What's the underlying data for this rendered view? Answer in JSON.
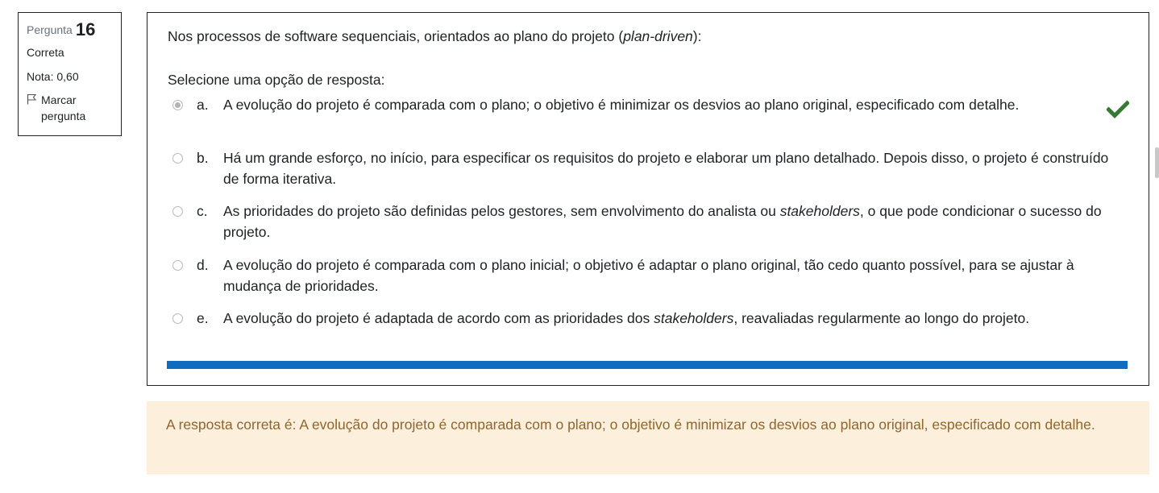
{
  "question_info": {
    "label": "Pergunta",
    "number": "16",
    "state": "Correta",
    "grade": "Nota: 0,60",
    "flag_label": "Marcar pergunta"
  },
  "question": {
    "text_before": "Nos processos de software sequenciais, orientados ao plano do projeto (",
    "text_italic": "plan-driven",
    "text_after": "):",
    "prompt": "Selecione uma opção de resposta:",
    "options": [
      {
        "letter": "a.",
        "text_before": "A evolução do projeto é comparada com o plano; o objetivo é minimizar os desvios ao plano original, especificado com detalhe.",
        "italic": "",
        "text_after": "",
        "selected": true,
        "correct": true
      },
      {
        "letter": "b.",
        "text_before": "Há um grande esforço, no início, para especificar os requisitos do projeto e elaborar um plano detalhado. Depois disso, o projeto é construído de forma iterativa.",
        "italic": "",
        "text_after": "",
        "selected": false
      },
      {
        "letter": "c.",
        "text_before": "As prioridades do projeto são definidas pelos gestores, sem envolvimento do analista ou ",
        "italic": "stakeholders",
        "text_after": ", o que pode condicionar o sucesso do projeto.",
        "selected": false
      },
      {
        "letter": "d.",
        "text_before": "A evolução do projeto é comparada com o plano inicial; o objetivo é adaptar o plano original, tão cedo quanto possível, para se ajustar à mudança de prioridades.",
        "italic": "",
        "text_after": "",
        "selected": false
      },
      {
        "letter": "e.",
        "text_before": "A evolução do projeto é adaptada de acordo com as prioridades dos ",
        "italic": "stakeholders",
        "text_after": ", reavaliadas regularmente ao longo do projeto.",
        "selected": false
      }
    ]
  },
  "feedback": {
    "text": "A resposta correta é: A evolução do projeto é comparada com o plano; o objetivo é minimizar os desvios ao plano original, especificado com detalhe."
  },
  "colors": {
    "correct_check": "#357a32",
    "progress_bar": "#0f6cbf",
    "feedback_bg": "#fcefdc",
    "feedback_text": "#8e662e"
  }
}
